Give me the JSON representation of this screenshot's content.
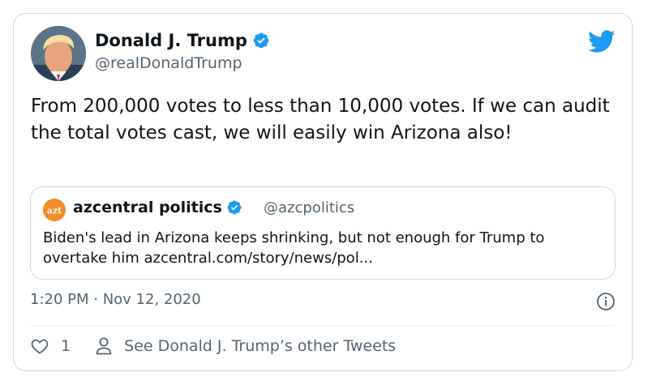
{
  "tweet": {
    "author": {
      "name": "Donald J. Trump",
      "handle": "@realDonaldTrump",
      "verified": true
    },
    "text": "From 200,000 votes to less than 10,000 votes. If we can audit the total votes cast, we will easily win Arizona also!",
    "timestamp": "1:20 PM · Nov 12, 2020",
    "like_count": "1",
    "other_tweets_label": "See Donald J. Trump’s other Tweets"
  },
  "quote": {
    "avatar_label": "azt",
    "name": "azcentral politics",
    "handle": "@azcpolitics",
    "verified": true,
    "text": "Biden's lead in Arizona keeps shrinking, but not enough for Trump to overtake him azcentral.com/story/news/pol..."
  },
  "icons": {
    "brand": "twitter-bird-icon",
    "verified": "verified-badge-icon",
    "info": "info-icon",
    "like": "heart-icon",
    "profile": "user-icon"
  },
  "colors": {
    "twitter_blue": "#1d9bf0",
    "text_primary": "#0f1419",
    "text_secondary": "#536471",
    "border": "#cfd9de",
    "azcentral_orange": "#f28c28"
  }
}
